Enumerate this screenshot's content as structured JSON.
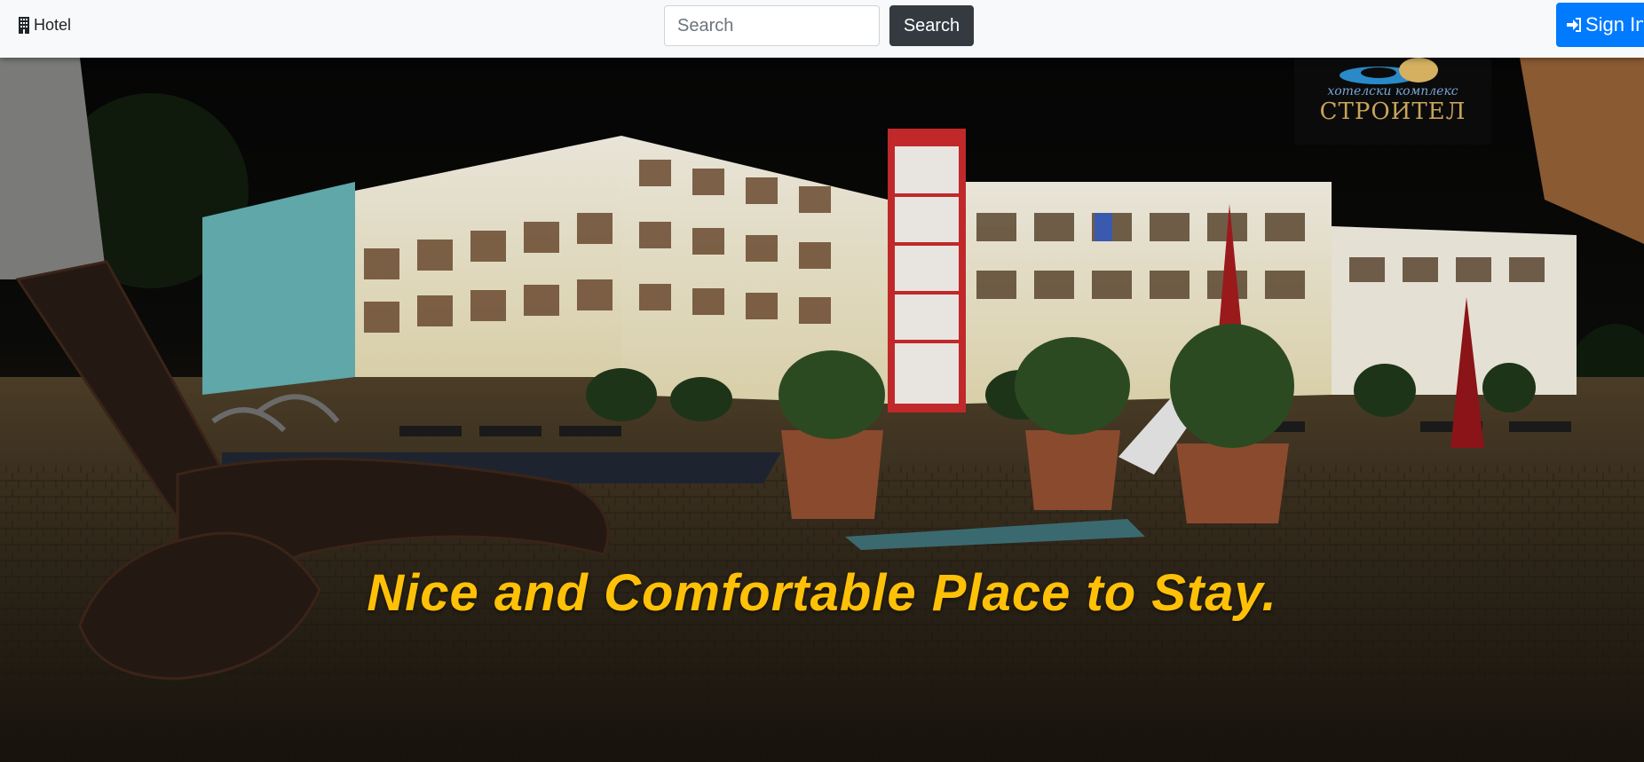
{
  "navbar": {
    "brand_label": "Hotel",
    "brand_icon": "building-icon",
    "search": {
      "placeholder": "Search",
      "value": "",
      "button_label": "Search"
    },
    "signin": {
      "label": "Sign In",
      "icon": "sign-in-icon",
      "color": "#007bff"
    }
  },
  "hero": {
    "headline": "Nice and Comfortable Place to Stay.",
    "headline_color": "#ffc107",
    "logo": {
      "subtitle": "хотелски комплекс",
      "name": "СТРОИТЕЛ"
    }
  }
}
